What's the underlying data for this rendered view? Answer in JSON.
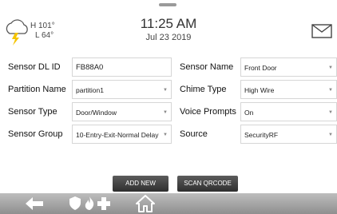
{
  "header": {
    "weather": {
      "icon": "cloud-lightning-icon",
      "high": "H 101°",
      "low": "L 64°"
    },
    "time": "11:25 AM",
    "date": "Jul 23 2019",
    "mail_icon": "envelope-icon"
  },
  "form": {
    "rows": [
      {
        "left": {
          "label": "Sensor DL ID",
          "value": "FB88A0",
          "kind": "input"
        },
        "right": {
          "label": "Sensor Name",
          "value": "Front Door",
          "kind": "select"
        }
      },
      {
        "left": {
          "label": "Partition Name",
          "value": "partition1",
          "kind": "select"
        },
        "right": {
          "label": "Chime Type",
          "value": "High Wire",
          "kind": "select"
        }
      },
      {
        "left": {
          "label": "Sensor Type",
          "value": "Door/Window",
          "kind": "select"
        },
        "right": {
          "label": "Voice Prompts",
          "value": "On",
          "kind": "select"
        }
      },
      {
        "left": {
          "label": "Sensor Group",
          "value": "10-Entry-Exit-Normal Delay",
          "kind": "select"
        },
        "right": {
          "label": "Source",
          "value": "SecurityRF",
          "kind": "select"
        }
      }
    ]
  },
  "buttons": {
    "add_new": "ADD NEW",
    "scan_qrcode": "SCAN QRCODE"
  },
  "navbar": {
    "icons": [
      "back-arrow-icon",
      "shield-icon",
      "fire-icon",
      "medical-cross-icon",
      "home-icon"
    ],
    "color": "#9e9e9e"
  },
  "colors": {
    "button_bg": "#3a3a3a",
    "lightning": "#f5c400"
  }
}
